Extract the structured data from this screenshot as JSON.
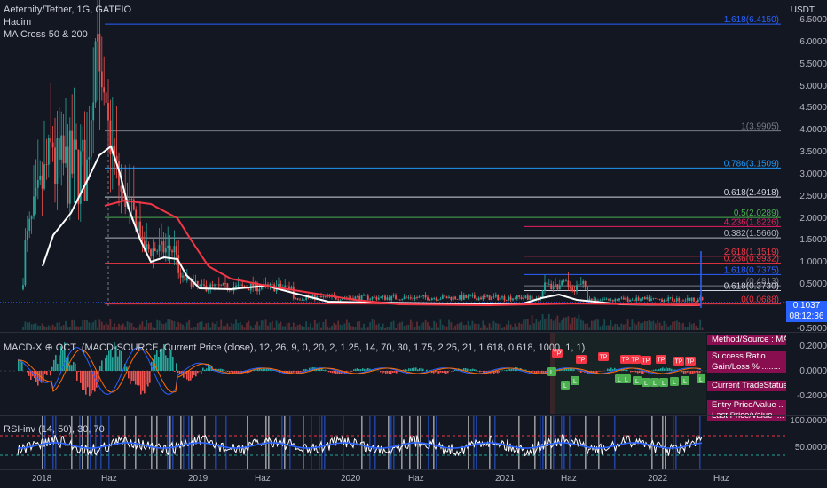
{
  "header": {
    "symbol_title": "Aeternity/Tether, 1G, GATEIO",
    "indicator_volume": "Hacim",
    "indicator_ma": "MA Cross 50 & 200",
    "currency": "USDT"
  },
  "price_axis": [
    "6.5000",
    "6.0000",
    "5.5000",
    "5.0000",
    "4.5000",
    "4.0000",
    "3.5000",
    "3.0000",
    "2.5000",
    "2.0000",
    "1.5000",
    "1.0000",
    "0.5000",
    "-0.5000"
  ],
  "current_price": {
    "value": "0.1037",
    "countdown": "08:12:36"
  },
  "fib_levels": [
    {
      "label": "1.618(6.4150)",
      "color": "#2962ff",
      "value": 6.415
    },
    {
      "label": "1(3.9905)",
      "color": "#787b86",
      "value": 3.9905
    },
    {
      "label": "0.786(3.1509)",
      "color": "#2196f3",
      "value": 3.1509
    },
    {
      "label": "0.618(2.4918)",
      "color": "#d1d4dc",
      "value": 2.4918
    },
    {
      "label": "0.5(2.0289)",
      "color": "#4caf50",
      "value": 2.0289
    },
    {
      "label": "4.236(1.8226)",
      "color": "#e91e63",
      "value": 1.8226
    },
    {
      "label": "0.382(1.5660)",
      "color": "#b2b5be",
      "value": 1.566
    },
    {
      "label": "2.618(1.1519)",
      "color": "#f23645",
      "value": 1.1519
    },
    {
      "label": "0.236(0.9932)",
      "color": "#f23645",
      "value": 0.9932
    },
    {
      "label": "1.618(0.7375)",
      "color": "#2962ff",
      "value": 0.7375
    },
    {
      "label": "(0.4813)",
      "color": "#787b86",
      "value": 0.4813
    },
    {
      "label": "0.618(0.3730)",
      "color": "#d1d4dc",
      "value": 0.373
    },
    {
      "label": "0(0.0688)",
      "color": "#f23645",
      "value": 0.0688
    }
  ],
  "macd": {
    "title": "MACD-X ⊕ OCT  (MACD-SOURCE, Current Price (close), 12, 26, 9, 0, 20, 2, 1.25, 14, 70, 30, 1.75, 2.25, 21, 1.618, 0.618, 1000, 1, 1)",
    "axis": [
      "0.2000",
      "0.0000",
      "-0.2000"
    ],
    "table": [
      "Method/Source : MA",
      "Success Ratio .......",
      "Gain/Loss % ........",
      "Current TradeStatus",
      "Entry Price/Value ..",
      "Last Price/Value ...."
    ],
    "markers_tp": "TP",
    "markers_l": "L"
  },
  "rsi": {
    "title": "RSI-inv (14, 50), 30, 70",
    "axis": [
      "100.0000",
      "50.0000"
    ]
  },
  "time_axis": [
    "2018",
    "Haz",
    "2019",
    "Haz",
    "2020",
    "Haz",
    "2021",
    "Haz",
    "2022",
    "Haz"
  ],
  "colors": {
    "background": "#131722",
    "bull": "#26a69a",
    "bear": "#ef5350",
    "ma50": "#ffffff",
    "ma200": "#f23645",
    "macd_line": "#2962ff",
    "signal_line": "#ff6d00",
    "rsi_line": "#ffffff",
    "rsi_ma": "#2962ff",
    "table_bg": "#880e4f"
  }
}
